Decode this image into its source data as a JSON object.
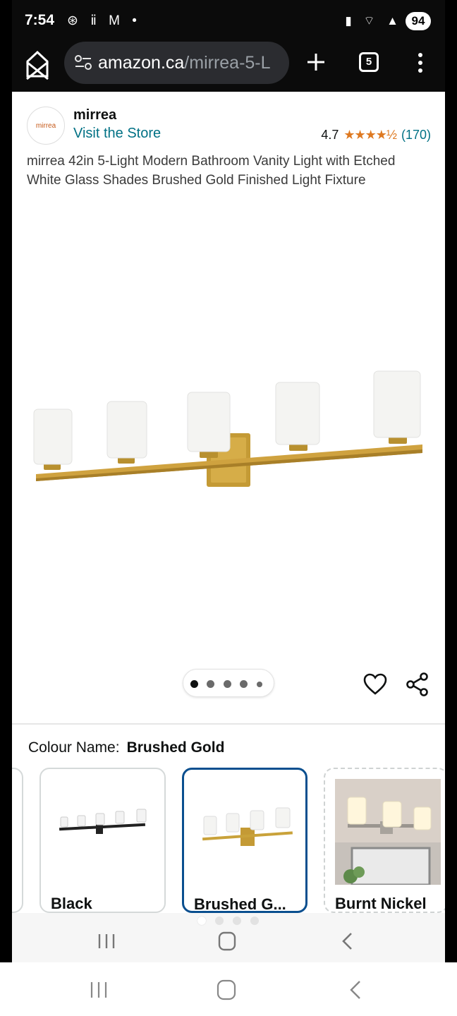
{
  "status_bar": {
    "time": "7:54",
    "left_icons": "⊛ ⅱ M •",
    "right_icons": "▮ ⌔ ▲",
    "battery": "94"
  },
  "browser": {
    "url_domain": "amazon.ca",
    "url_path": "/mirrea-5-L",
    "tab_count": "5"
  },
  "store": {
    "logo_text": "mirrea",
    "brand_name": "mirrea",
    "visit_store": "Visit the Store",
    "rating_value": "4.7",
    "rating_stars": "★★★★½",
    "rating_count": "(170)",
    "rating_fraction": 0.94
  },
  "product": {
    "title": "mirrea 42in 5-Light Modern Bathroom Vanity Light with Etched White Glass Shades Brushed Gold Finished Light Fixture",
    "image_count": 5,
    "active_image": 1
  },
  "colour": {
    "label": "Colour Name:",
    "selected": "Brushed Gold",
    "options": [
      {
        "label": "Black",
        "selected": false
      },
      {
        "label": "Brushed G...",
        "selected": true
      },
      {
        "label": "Burnt Nickel",
        "selected": false
      }
    ]
  },
  "colors": {
    "link": "#007185",
    "star": "#de7921",
    "selected_border": "#0a4f8f",
    "gold": "#c9a23a"
  }
}
